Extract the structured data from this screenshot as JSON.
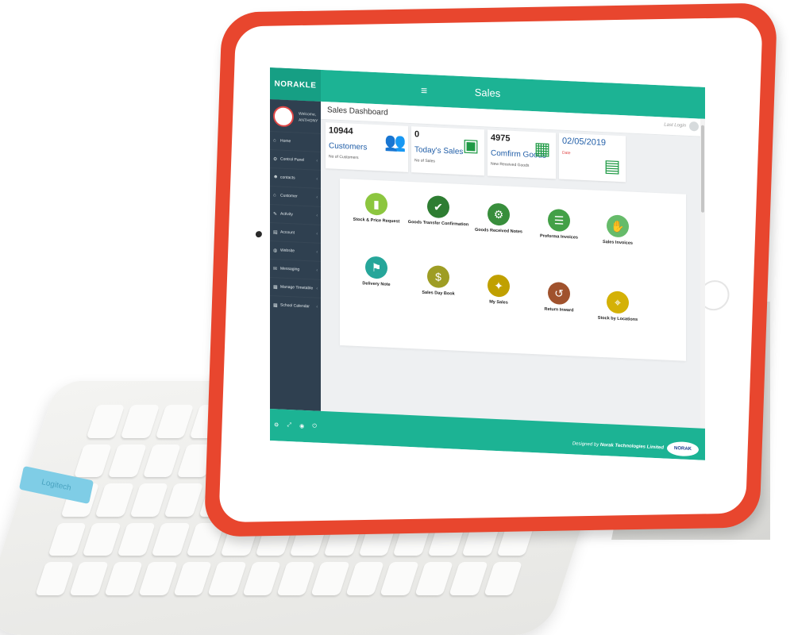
{
  "app": {
    "brand": "NORAKLE",
    "title": "Sales",
    "menu_icon": "hamburger-icon"
  },
  "profile": {
    "welcome": "Welcome,",
    "name": "ANTHONY"
  },
  "sidebar": {
    "items": [
      {
        "label": "Home",
        "icon": "home-icon",
        "chevron": ""
      },
      {
        "label": "Control Panel",
        "icon": "cogs-icon",
        "chevron": "‹"
      },
      {
        "label": "contacts",
        "icon": "users-icon",
        "chevron": "‹"
      },
      {
        "label": "Customer",
        "icon": "home-icon",
        "chevron": "‹"
      },
      {
        "label": "Activity",
        "icon": "pen-icon",
        "chevron": "‹"
      },
      {
        "label": "Account",
        "icon": "book-icon",
        "chevron": "‹"
      },
      {
        "label": "Website",
        "icon": "globe-icon",
        "chevron": "‹"
      },
      {
        "label": "Messaging",
        "icon": "envelope-icon",
        "chevron": "‹"
      },
      {
        "label": "Manage Timetable",
        "icon": "calendar-icon",
        "chevron": "‹"
      },
      {
        "label": "School Calendar",
        "icon": "calendar-icon",
        "chevron": "‹"
      }
    ],
    "footer_icons": [
      "gear-icon",
      "expand-icon",
      "eye-icon",
      "power-icon"
    ]
  },
  "header": {
    "page_title": "Sales Dashboard",
    "last_login": "Last Login"
  },
  "stats": [
    {
      "number": "10944",
      "title": "Customers",
      "sub": "No of Customers",
      "icon": "users-icon"
    },
    {
      "number": "0",
      "title": "Today's Sales",
      "sub": "No of Sales",
      "icon": "money-icon"
    },
    {
      "number": "4975",
      "title": "Comfirm Goods",
      "sub": "New Received Goods",
      "icon": "boxes-icon"
    },
    {
      "number": "02/05/2019",
      "title": "",
      "sub": "Date",
      "icon": "calendar-icon"
    }
  ],
  "apps": [
    {
      "label": "Stock & Price Request",
      "icon": "battery-icon",
      "color": "#8cc63f"
    },
    {
      "label": "Goods Transfer Confirmation",
      "icon": "truck-icon",
      "color": "#2e7d32"
    },
    {
      "label": "Goods Received Notes",
      "icon": "forklift-icon",
      "color": "#388e3c"
    },
    {
      "label": "Proforma Invoices",
      "icon": "clipboard-icon",
      "color": "#43a047"
    },
    {
      "label": "Sales Invoices",
      "icon": "handshake-icon",
      "color": "#66bb6a"
    },
    {
      "label": "Delivery Note",
      "icon": "delivery-icon",
      "color": "#26a69a"
    },
    {
      "label": "Sales Day Book",
      "icon": "cash-icon",
      "color": "#9e9d24"
    },
    {
      "label": "My Sales",
      "icon": "chart-icon",
      "color": "#c0a000"
    },
    {
      "label": "Return Inward",
      "icon": "box-return-icon",
      "color": "#a0522d"
    },
    {
      "label": "Stock by Locations",
      "icon": "location-icon",
      "color": "#d4b106"
    }
  ],
  "footer": {
    "credit_prefix": "Designed by",
    "company": "Norak Technologies Limited",
    "logo_text": "NORAK"
  },
  "keyboard": {
    "brand_tab": "Logitech"
  }
}
